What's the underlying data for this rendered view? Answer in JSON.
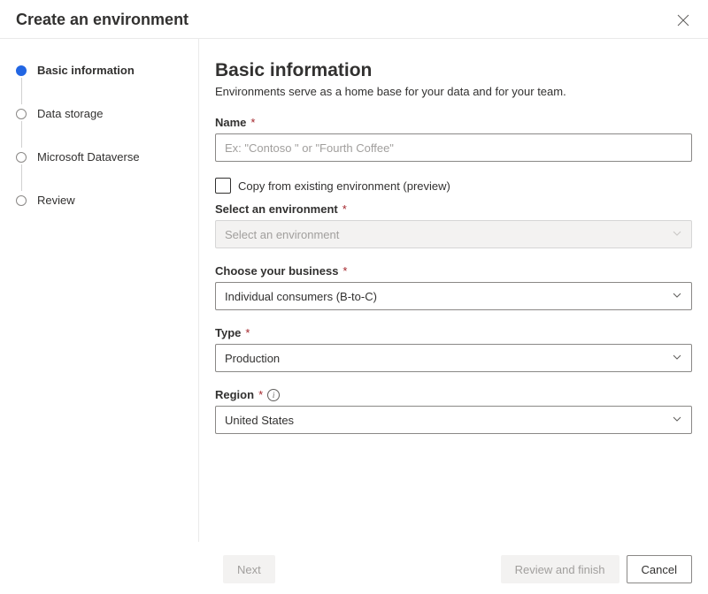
{
  "header": {
    "title": "Create an environment"
  },
  "steps": [
    {
      "label": "Basic information",
      "active": true
    },
    {
      "label": "Data storage",
      "active": false
    },
    {
      "label": "Microsoft Dataverse",
      "active": false
    },
    {
      "label": "Review",
      "active": false
    }
  ],
  "main": {
    "heading": "Basic information",
    "subheading": "Environments serve as a home base for your data and for your team.",
    "name_label": "Name",
    "name_placeholder": "Ex: \"Contoso \" or \"Fourth Coffee\"",
    "copy_checkbox_label": "Copy from existing environment (preview)",
    "select_env_label": "Select an environment",
    "select_env_placeholder": "Select an environment",
    "business_label": "Choose your business",
    "business_value": "Individual consumers (B-to-C)",
    "type_label": "Type",
    "type_value": "Production",
    "region_label": "Region",
    "region_value": "United States"
  },
  "footer": {
    "next": "Next",
    "review": "Review and finish",
    "cancel": "Cancel"
  }
}
